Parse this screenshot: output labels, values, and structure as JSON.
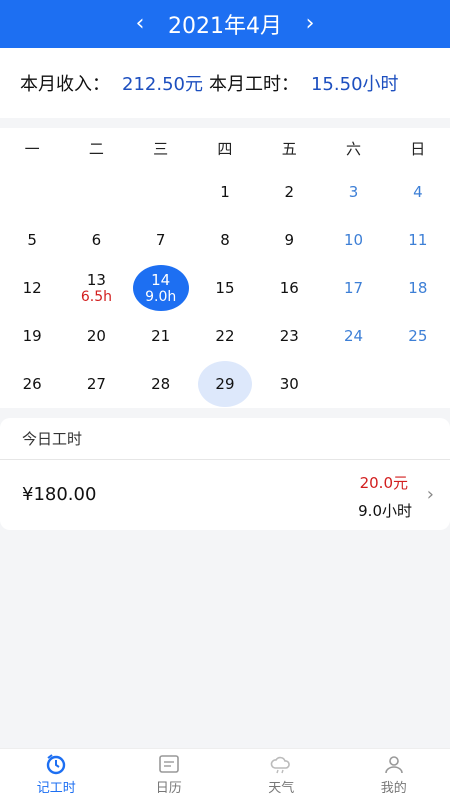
{
  "header": {
    "prev": "‹",
    "title": "2021年4月",
    "next": "›"
  },
  "summary": {
    "income_label": "本月收入：",
    "income_value": "212.50元",
    "hours_label": "本月工时：",
    "hours_value": "15.50小时"
  },
  "calendar": {
    "weekdays": [
      "一",
      "二",
      "三",
      "四",
      "五",
      "六",
      "日"
    ],
    "days": [
      {
        "n": "1"
      },
      {
        "n": "2"
      },
      {
        "n": "3"
      },
      {
        "n": "4"
      },
      {
        "n": "5"
      },
      {
        "n": "6"
      },
      {
        "n": "7"
      },
      {
        "n": "8"
      },
      {
        "n": "9"
      },
      {
        "n": "10"
      },
      {
        "n": "11"
      },
      {
        "n": "12"
      },
      {
        "n": "13",
        "h": "6.5h"
      },
      {
        "n": "14",
        "h": "9.0h"
      },
      {
        "n": "15"
      },
      {
        "n": "16"
      },
      {
        "n": "17"
      },
      {
        "n": "18"
      },
      {
        "n": "19"
      },
      {
        "n": "20"
      },
      {
        "n": "21"
      },
      {
        "n": "22"
      },
      {
        "n": "23"
      },
      {
        "n": "24"
      },
      {
        "n": "25"
      },
      {
        "n": "26"
      },
      {
        "n": "27"
      },
      {
        "n": "28"
      },
      {
        "n": "29"
      },
      {
        "n": "30"
      }
    ],
    "selected_day": "14",
    "today": "29"
  },
  "today_panel": {
    "title": "今日工时",
    "amount": "¥180.00",
    "rate": "20.0元",
    "hours": "9.0小时"
  },
  "tabs": [
    {
      "label": "记工时",
      "icon": "clock-record-icon"
    },
    {
      "label": "日历",
      "icon": "calendar-icon"
    },
    {
      "label": "天气",
      "icon": "weather-icon"
    },
    {
      "label": "我的",
      "icon": "user-icon"
    }
  ],
  "colors": {
    "primary": "#1d6ff2",
    "hours_red": "#d21e1e",
    "weekend_blue": "#3d7fd6",
    "today_bg": "#dde8fb"
  }
}
